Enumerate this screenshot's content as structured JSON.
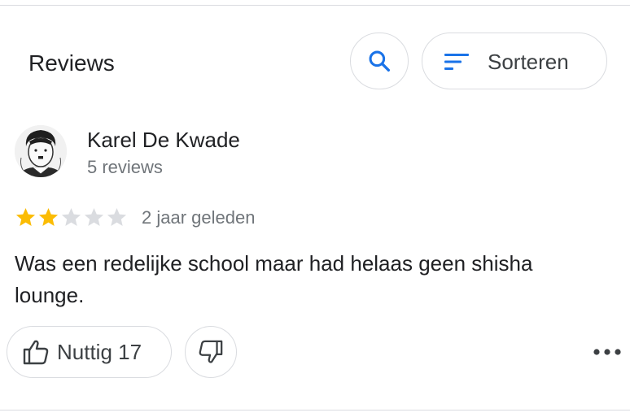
{
  "header": {
    "title": "Reviews",
    "search_icon": "search-icon",
    "sort_label": "Sorteren",
    "sort_icon": "sort-icon"
  },
  "review": {
    "reviewer_name": "Karel De Kwade",
    "reviewer_count": "5 reviews",
    "rating": 2,
    "max_rating": 5,
    "date": "2 jaar geleden",
    "text": "Was een redelijke school maar had helaas geen shisha lounge.",
    "helpful_label": "Nuttig 17",
    "colors": {
      "star_filled": "#fbbc04",
      "star_empty": "#dadce0",
      "accent": "#1a73e8"
    }
  },
  "actions": {
    "helpful_icon": "thumbs-up-icon",
    "dislike_icon": "thumbs-down-icon",
    "more_icon": "more-horizontal-icon"
  }
}
